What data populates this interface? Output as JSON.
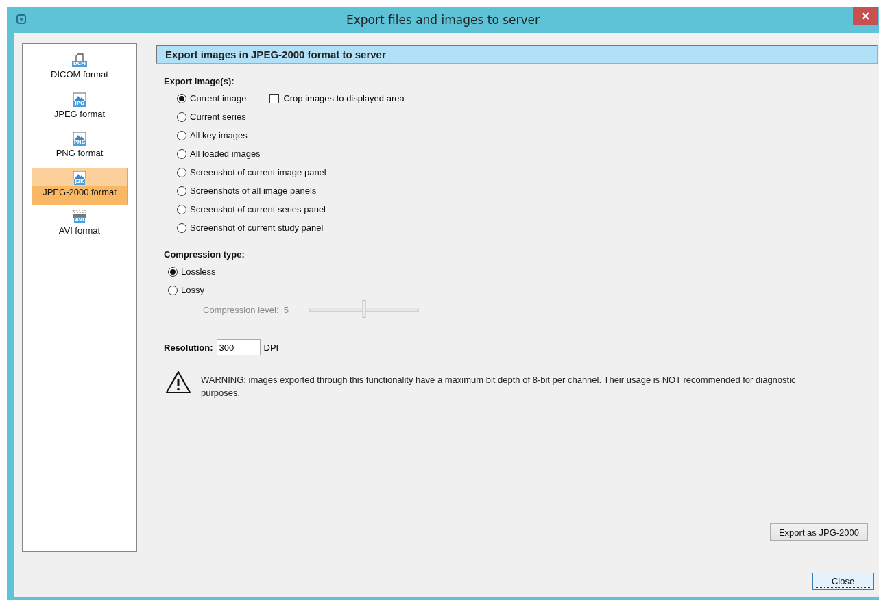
{
  "window": {
    "title": "Export files and images to server"
  },
  "sidebar": {
    "items": [
      {
        "label": "DICOM format",
        "icon_label": "DCM",
        "kind": "document",
        "selected": false
      },
      {
        "label": "JPEG format",
        "icon_label": "JPG",
        "kind": "image",
        "selected": false
      },
      {
        "label": "PNG format",
        "icon_label": "PNG",
        "kind": "image",
        "selected": false
      },
      {
        "label": "JPEG-2000 format",
        "icon_label": "J2K",
        "kind": "image",
        "selected": true
      },
      {
        "label": "AVI format",
        "icon_label": "AVI",
        "kind": "video",
        "selected": false
      }
    ]
  },
  "panel": {
    "title": "Export images in JPEG-2000 format to server",
    "export_section": {
      "heading": "Export image(s):",
      "options": [
        {
          "label": "Current image",
          "selected": true
        },
        {
          "label": "Current series",
          "selected": false
        },
        {
          "label": "All key images",
          "selected": false
        },
        {
          "label": "All loaded images",
          "selected": false
        },
        {
          "label": "Screenshot of current image panel",
          "selected": false
        },
        {
          "label": "Screenshots of all image panels",
          "selected": false
        },
        {
          "label": "Screenshot of current series panel",
          "selected": false
        },
        {
          "label": "Screenshot of current study panel",
          "selected": false
        }
      ],
      "crop_checkbox": {
        "label": "Crop images to displayed area",
        "checked": false
      }
    },
    "compression_section": {
      "heading": "Compression type:",
      "options": [
        {
          "label": "Lossless",
          "selected": true
        },
        {
          "label": "Lossy",
          "selected": false
        }
      ],
      "level": {
        "label": "Compression level:",
        "value": "5",
        "disabled": true,
        "level": 0.5
      }
    },
    "resolution": {
      "label": "Resolution:",
      "value": "300",
      "unit": "DPI"
    },
    "warning": "WARNING: images exported through this functionality have a maximum bit depth of 8-bit per channel. Their usage is NOT recommended for diagnostic purposes.",
    "export_button": "Export as JPG-2000"
  },
  "buttons": [
    {
      "label": "Close",
      "focused": true
    }
  ]
}
